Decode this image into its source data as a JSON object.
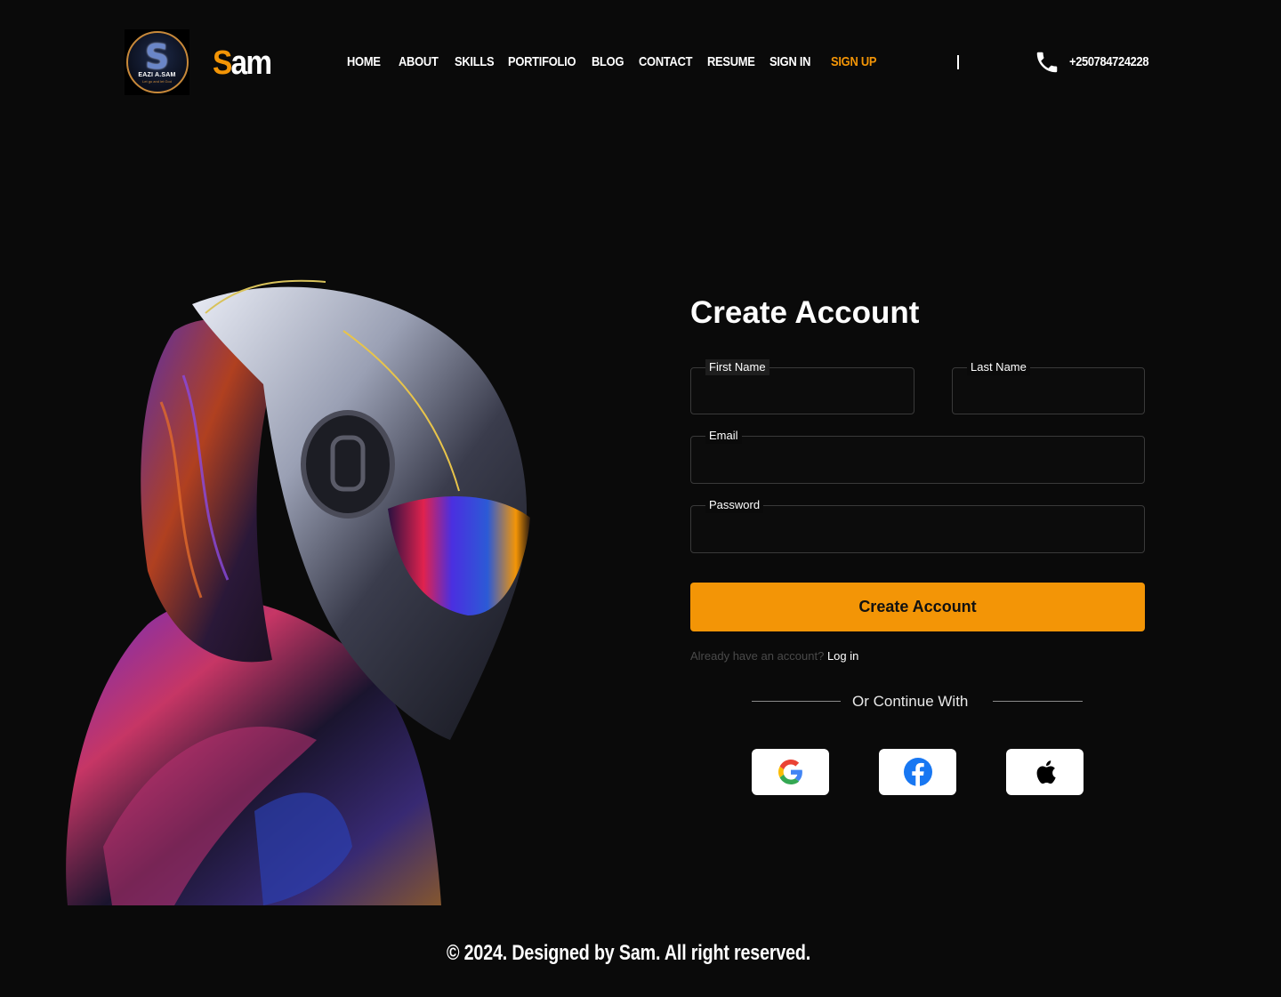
{
  "header": {
    "logo": {
      "initial": "S",
      "name": "EAZI A.SAM",
      "tagline": "Let go and let God"
    },
    "brand": {
      "first_letter": "S",
      "rest": "am"
    },
    "nav": [
      {
        "label": "HOME"
      },
      {
        "label": "ABOUT"
      },
      {
        "label": "SKILLS"
      },
      {
        "label": "PORTIFOLIO"
      },
      {
        "label": "BLOG"
      },
      {
        "label": "CONTACT"
      },
      {
        "label": "RESUME"
      },
      {
        "label": "SIGN IN"
      },
      {
        "label": "SIGN UP",
        "active": true
      }
    ],
    "separator": "|",
    "phone_icon": "phone-icon",
    "phone": "+250784724228"
  },
  "hero": {
    "image": "chrome-helmet-figure-illustration"
  },
  "form": {
    "title": "Create Account",
    "first_name": {
      "label": "First Name",
      "value": ""
    },
    "last_name": {
      "label": "Last Name",
      "value": ""
    },
    "email": {
      "label": "Email",
      "value": ""
    },
    "password": {
      "label": "Password",
      "value": ""
    },
    "submit_label": "Create Account",
    "already_text": "Already have an account?",
    "login_link": "Log in",
    "divider_text": "Or Continue With",
    "social": [
      {
        "icon": "google-icon"
      },
      {
        "icon": "facebook-icon"
      },
      {
        "icon": "apple-icon"
      }
    ]
  },
  "footer": {
    "text": "© 2024. Designed by Sam. All right reserved."
  },
  "colors": {
    "background": "#0a0a0a",
    "accent": "#f39506",
    "text": "#ffffff",
    "border": "#3a3a3a"
  }
}
